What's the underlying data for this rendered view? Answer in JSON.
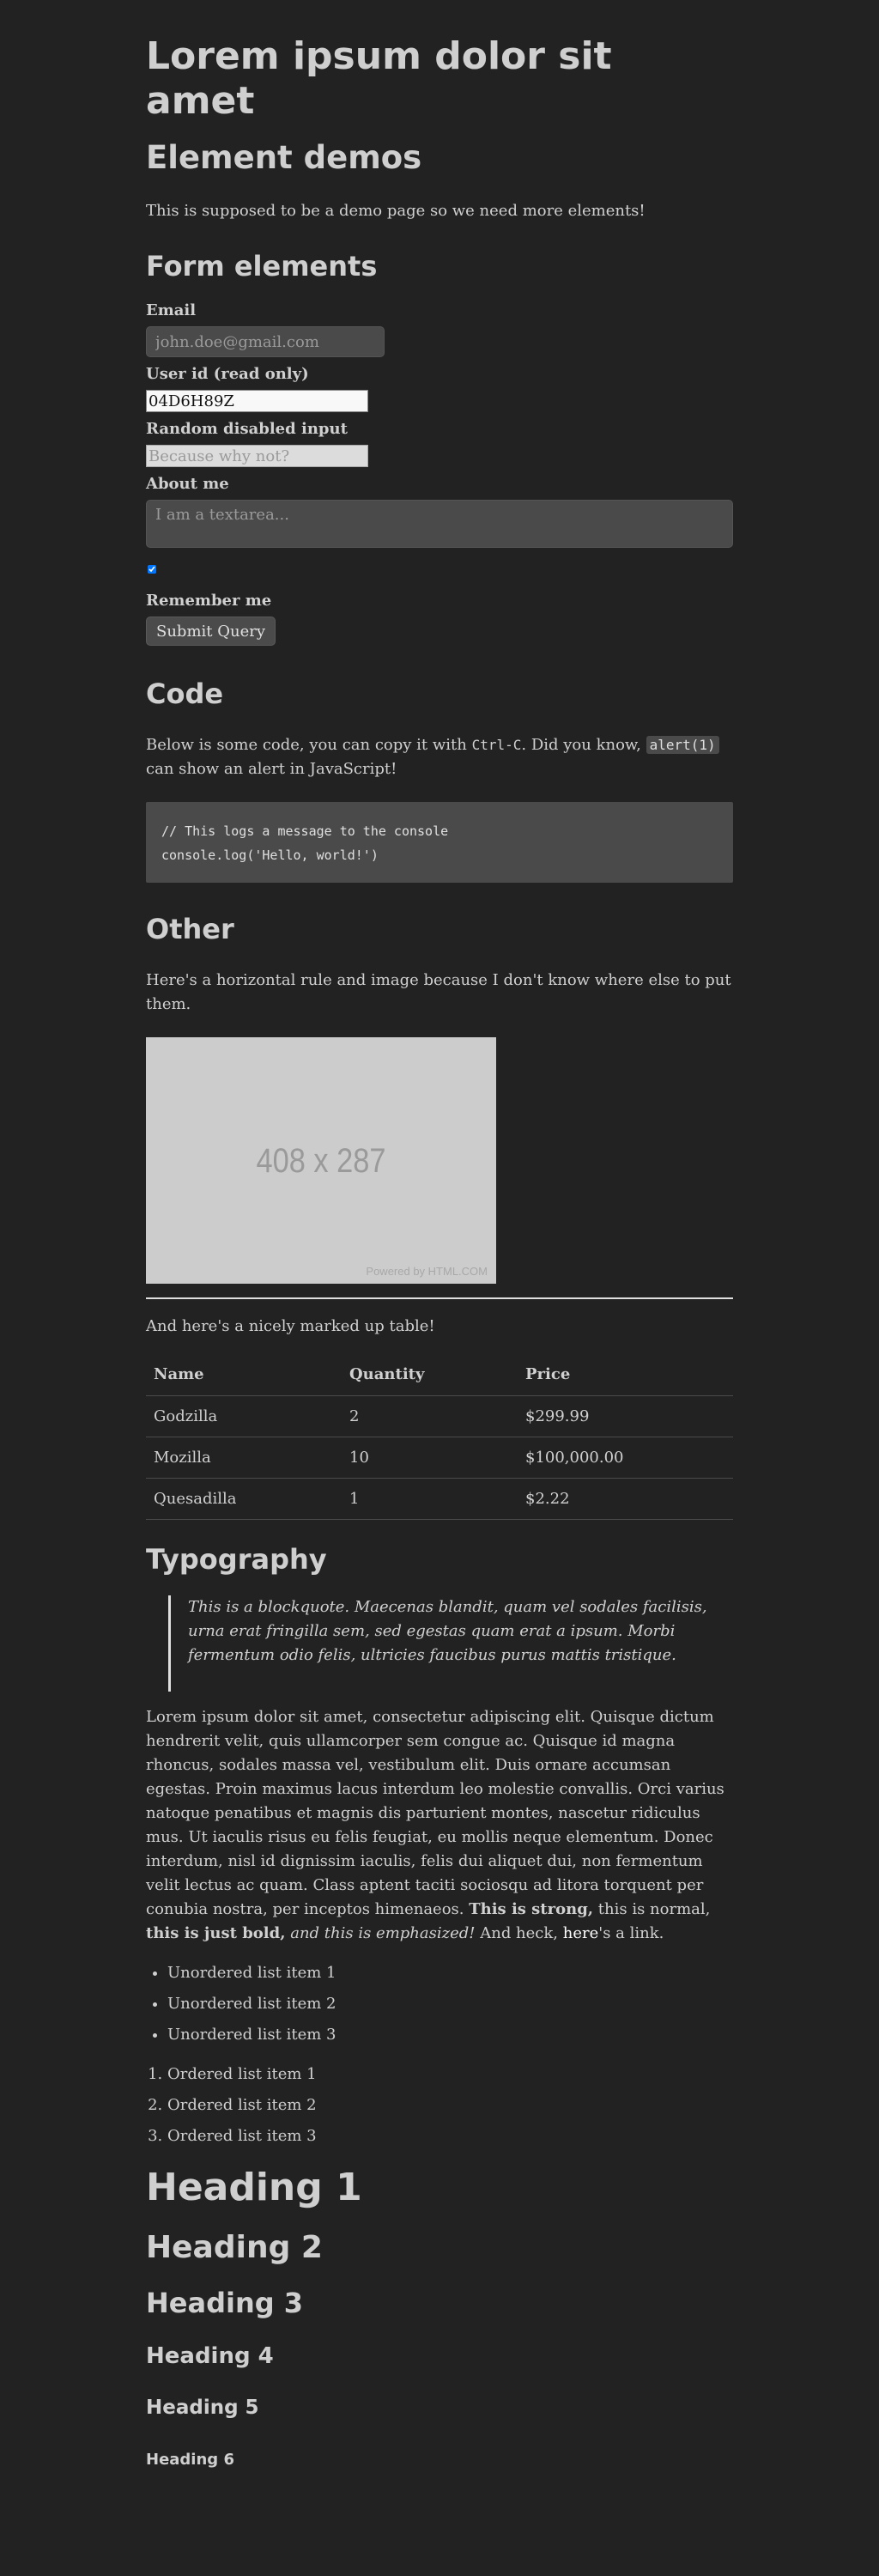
{
  "page_title": "Lorem ipsum dolor sit amet",
  "demo_heading": "Element demos",
  "intro": "This is supposed to be a demo page so we need more elements!",
  "form": {
    "heading": "Form elements",
    "email_label": "Email",
    "email_placeholder": "john.doe@gmail.com",
    "userid_label": "User id (read only)",
    "userid_value": "04D6H89Z",
    "disabled_label": "Random disabled input",
    "disabled_placeholder": "Because why not?",
    "about_label": "About me",
    "about_placeholder": "I am a textarea...",
    "checkbox_checked": true,
    "remember_label": "Remember me",
    "submit_label": "Submit Query"
  },
  "code": {
    "heading": "Code",
    "text_1": "Below is some code, you can copy it with ",
    "shortcut": "Ctrl-C",
    "text_2": ". Did you know, ",
    "inline_code": "alert(1)",
    "text_3": " can show an alert in JavaScript!",
    "block_line_1": "// This logs a message to the console",
    "block_line_2": "console.log('Hello, world!')"
  },
  "other": {
    "heading": "Other",
    "text": "Here's a horizontal rule and image because I don't know where else to put them.",
    "image_label": "408 x 287",
    "image_credit": "Powered by HTML.COM",
    "table_intro": "And here's a nicely marked up table!",
    "table": {
      "headers": [
        "Name",
        "Quantity",
        "Price"
      ],
      "rows": [
        [
          "Godzilla",
          "2",
          "$299.99"
        ],
        [
          "Mozilla",
          "10",
          "$100,000.00"
        ],
        [
          "Quesadilla",
          "1",
          "$2.22"
        ]
      ]
    }
  },
  "typography": {
    "heading": "Typography",
    "blockquote": "This is a blockquote. Maecenas blandit, quam vel sodales facilisis, urna erat fringilla sem, sed egestas quam erat a ipsum. Morbi fermentum odio felis, ultricies faucibus purus mattis tristique.",
    "lorem": "Lorem ipsum dolor sit amet, consectetur adipiscing elit. Quisque dictum hendrerit velit, quis ullamcorper sem congue ac. Quisque id magna rhoncus, sodales massa vel, vestibulum elit. Duis ornare accumsan egestas. Proin maximus lacus interdum leo molestie convallis. Orci varius natoque penatibus et magnis dis parturient montes, nascetur ridiculus mus. Ut iaculis risus eu felis feugiat, eu mollis neque elementum. Donec interdum, nisl id dignissim iaculis, felis dui aliquet dui, non fermentum velit lectus ac quam. Class aptent taciti sociosqu ad litora torquent per conubia nostra, per inceptos himenaeos. ",
    "strong_text": "This is strong,",
    "normal_text": " this is normal, ",
    "bold_text": "this is just bold,",
    "em_text": "and this is emphasized!",
    "and_heck": " And heck, ",
    "link_text": "here",
    "link_tail": "'s a link.",
    "unordered": [
      "Unordered list item 1",
      "Unordered list item 2",
      "Unordered list item 3"
    ],
    "ordered": [
      "Ordered list item 1",
      "Ordered list item 2",
      "Ordered list item 3"
    ],
    "headings": [
      "Heading 1",
      "Heading 2",
      "Heading 3",
      "Heading 4",
      "Heading 5",
      "Heading 6"
    ]
  }
}
